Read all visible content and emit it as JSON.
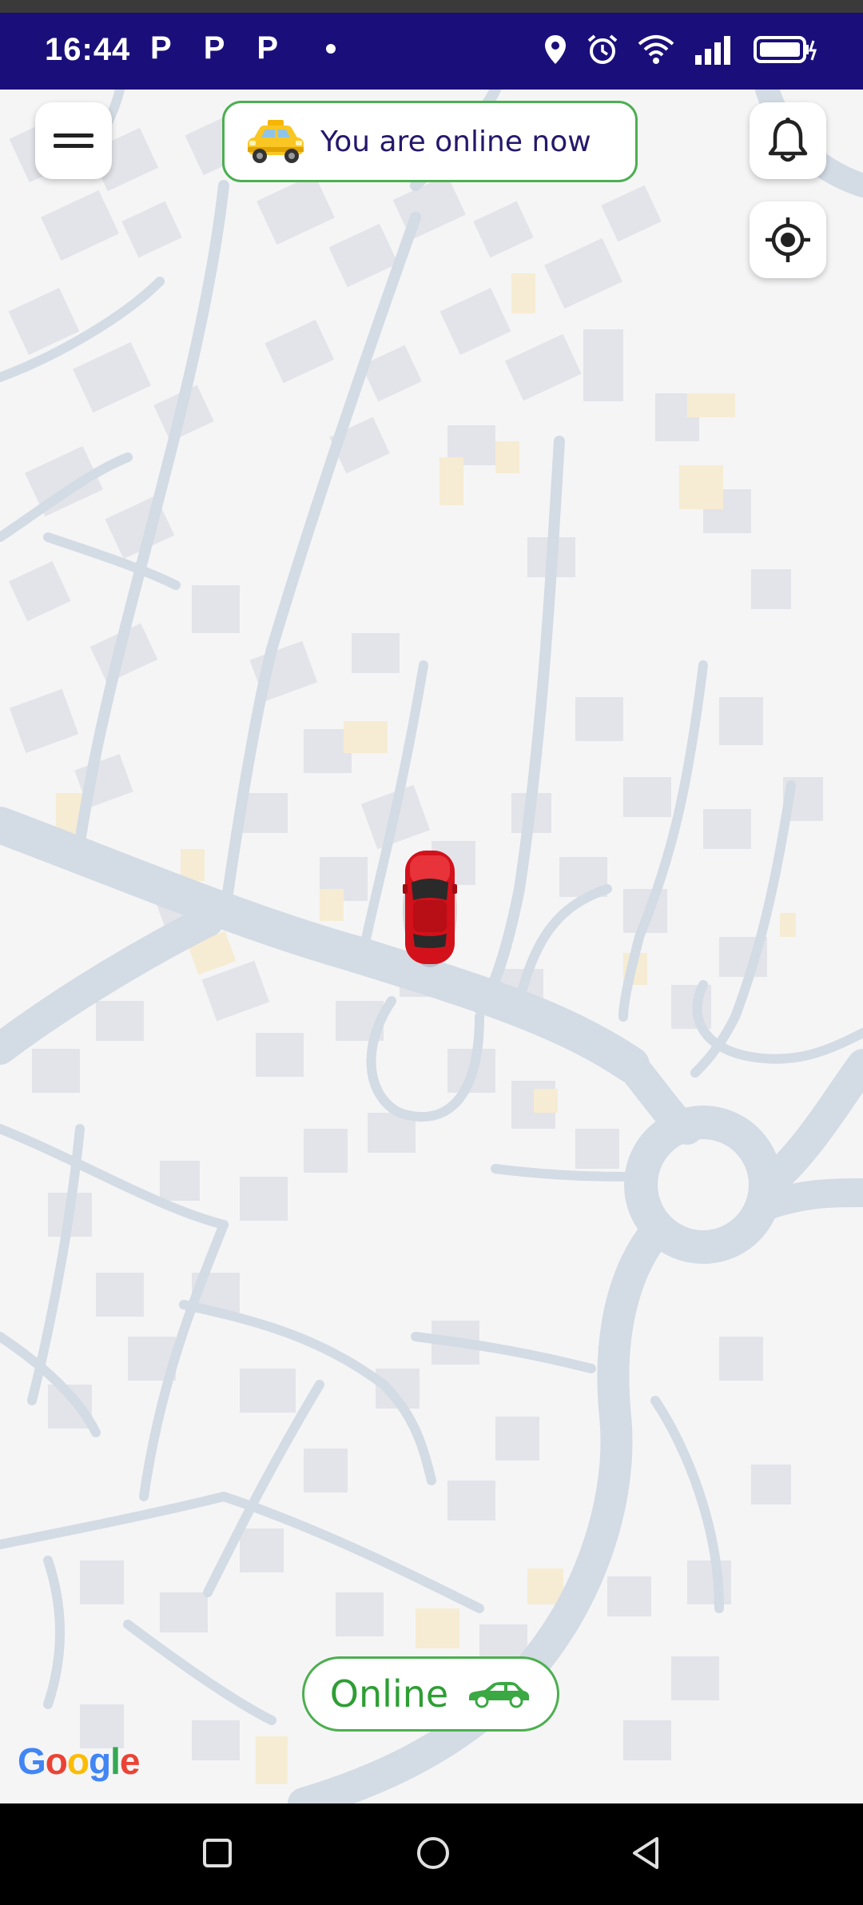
{
  "status_bar": {
    "time": "16:44",
    "notification_apps": [
      "P",
      "P",
      "P"
    ],
    "icons": [
      "location-icon",
      "alarm-icon",
      "wifi-icon",
      "signal-icon",
      "battery-charging-icon"
    ],
    "background": "#1a0f7a"
  },
  "header": {
    "menu_icon": "hamburger-menu-icon",
    "status_banner_text": "You are online now",
    "status_banner_icon": "taxi-icon",
    "bell_icon": "bell-icon",
    "locate_icon": "my-location-icon"
  },
  "map": {
    "vehicle_icon": "red-car-icon",
    "attribution": "Google",
    "attribution_colors": [
      "#4285F4",
      "#EA4335",
      "#FBBC05",
      "#4285F4",
      "#34A853",
      "#EA4335"
    ]
  },
  "footer": {
    "online_label": "Online",
    "online_icon": "car-icon",
    "accent_color": "#4caf50"
  },
  "nav_bar": {
    "icons": [
      "recent-apps-icon",
      "home-icon",
      "back-icon"
    ]
  }
}
